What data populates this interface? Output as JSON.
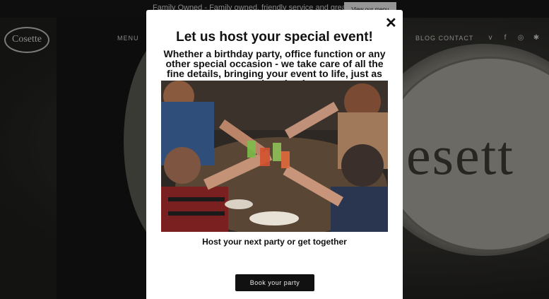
{
  "announcement": {
    "text": "Family Owned - Family owned, friendly service and great food!",
    "button_label": "View our menu"
  },
  "header": {
    "logo_text": "Cosette",
    "nav_left_label": "MENU",
    "nav_right_label": "BLOG   CONTACT",
    "social_icons": [
      "vimeo-icon",
      "facebook-icon",
      "instagram-icon",
      "yelp-icon"
    ]
  },
  "background": {
    "sign_text": "esett"
  },
  "modal": {
    "title": "Let us host your special event!",
    "subtitle": "Whether a birthday party, office function or any other special occasion - we take care of all the fine details, bringing your event to life, just as you imagined.",
    "caption": "Host your next party or get together",
    "button_label": "Book your party",
    "close_symbol": "✕"
  }
}
